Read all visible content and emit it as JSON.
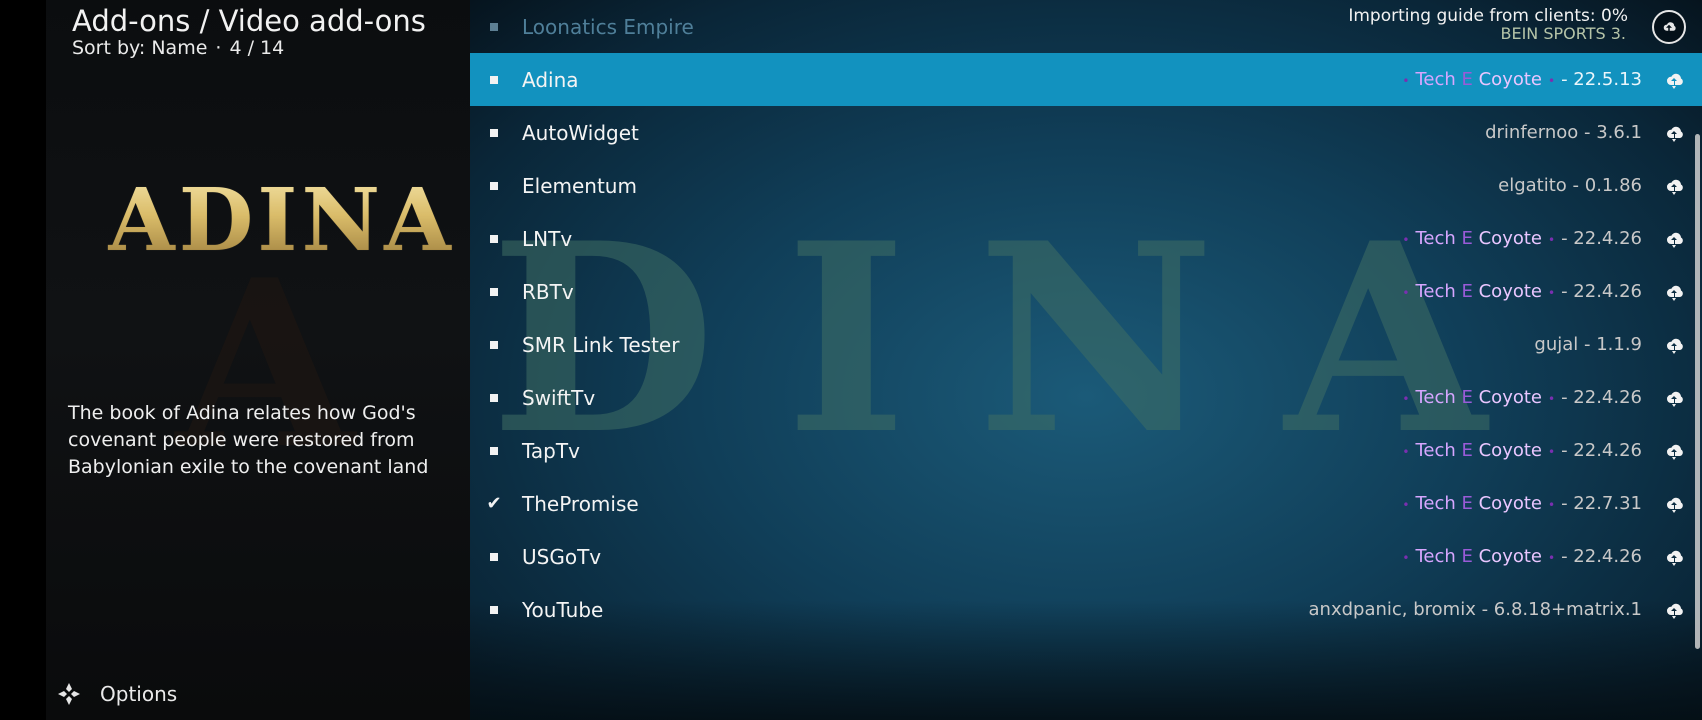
{
  "header": {
    "title": "Add-ons / Video add-ons",
    "sort_label": "Sort by: Name",
    "separator": "·",
    "position": "4 / 14"
  },
  "preview": {
    "logo_text": "ADINA",
    "description": "The book of Adina relates how God's covenant people were restored from Babylonian exile to the covenant land"
  },
  "footer": {
    "options_label": "Options"
  },
  "background": {
    "letters": [
      "D",
      "I",
      "N",
      "A"
    ]
  },
  "notification": {
    "text": "Importing guide from clients:  0%",
    "subtext": "BEIN SPORTS 3."
  },
  "list": {
    "items": [
      {
        "name": "Loonatics Empire",
        "meta": "",
        "type": "plain",
        "state": "dim"
      },
      {
        "name": "Adina",
        "meta": "- 22.5.13",
        "type": "tech",
        "state": "focused"
      },
      {
        "name": "AutoWidget",
        "meta": "drinfernoo - 3.6.1",
        "type": "plain",
        "state": ""
      },
      {
        "name": "Elementum",
        "meta": "elgatito - 0.1.86",
        "type": "plain",
        "state": ""
      },
      {
        "name": "LNTv",
        "meta": "- 22.4.26",
        "type": "tech",
        "state": ""
      },
      {
        "name": "RBTv",
        "meta": "- 22.4.26",
        "type": "tech",
        "state": ""
      },
      {
        "name": "SMR Link Tester",
        "meta": "gujal - 1.1.9",
        "type": "plain",
        "state": ""
      },
      {
        "name": "SwiftTv",
        "meta": "- 22.4.26",
        "type": "tech",
        "state": ""
      },
      {
        "name": "TapTv",
        "meta": "- 22.4.26",
        "type": "tech",
        "state": ""
      },
      {
        "name": "ThePromise",
        "meta": "- 22.7.31",
        "type": "tech",
        "state": "installed"
      },
      {
        "name": "USGoTv",
        "meta": "- 22.4.26",
        "type": "tech",
        "state": ""
      },
      {
        "name": "YouTube",
        "meta": "anxdpanic, bromix - 6.8.18+matrix.1",
        "type": "plain",
        "state": ""
      }
    ],
    "tech_author": {
      "dot": "•",
      "tech": "Tech",
      "e": "E",
      "coyote": "Coyote"
    },
    "check_glyph": "✔"
  },
  "colors": {
    "focus": "#1292bf",
    "author_purple": "#b44ee0",
    "author_lavender": "#d7a6ff"
  }
}
